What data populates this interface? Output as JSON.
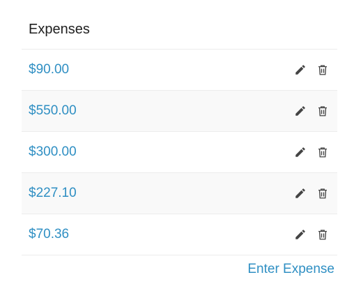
{
  "card": {
    "title": "Expenses"
  },
  "expenses": [
    {
      "amount": "$90.00"
    },
    {
      "amount": "$550.00"
    },
    {
      "amount": "$300.00"
    },
    {
      "amount": "$227.10"
    },
    {
      "amount": "$70.36"
    }
  ],
  "row_actions": {
    "edit_icon": "pencil-icon",
    "delete_icon": "trash-icon"
  },
  "footer": {
    "enter_label": "Enter Expense"
  },
  "colors": {
    "accent": "#2f8fc3",
    "icon": "#444444",
    "alt_row": "#f9f9f9",
    "divider": "#ececec"
  }
}
